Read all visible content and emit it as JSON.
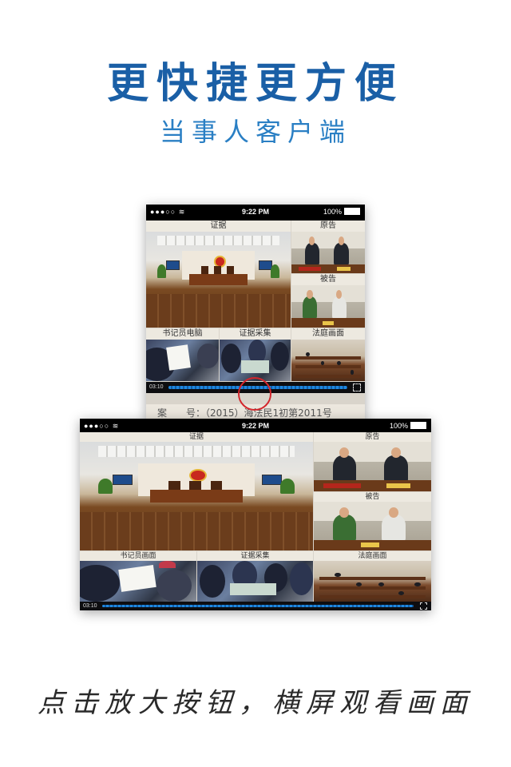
{
  "headline": "更快捷更方便",
  "subheadline": "当事人客户端",
  "caption": "点击放大按钮，横屏观看画面",
  "status_bar": {
    "signal": "●●●○○",
    "time": "9:22 PM",
    "battery": "100%"
  },
  "portrait": {
    "panels": {
      "evidence": "证据",
      "plaintiff": "原告",
      "defendant": "被告",
      "clerk": "书记员电脑",
      "collection": "证据采集",
      "court": "法庭画面"
    },
    "player": {
      "time": "03:10"
    },
    "case_no": "案　　号：（2015）海法民1初第2011号"
  },
  "landscape": {
    "panels": {
      "evidence": "证据",
      "plaintiff": "原告",
      "defendant": "被告",
      "clerk": "书记员画面",
      "collection": "证据采集",
      "court": "法庭画面"
    },
    "player": {
      "time": "03:10"
    }
  },
  "colors": {
    "headline": "#1a5fa6",
    "subheadline": "#2a7fc4",
    "highlight_ring": "#d3252b",
    "progress": "#1f88e0"
  },
  "icons": [
    "wifi-icon",
    "battery-icon",
    "fullscreen-icon"
  ]
}
